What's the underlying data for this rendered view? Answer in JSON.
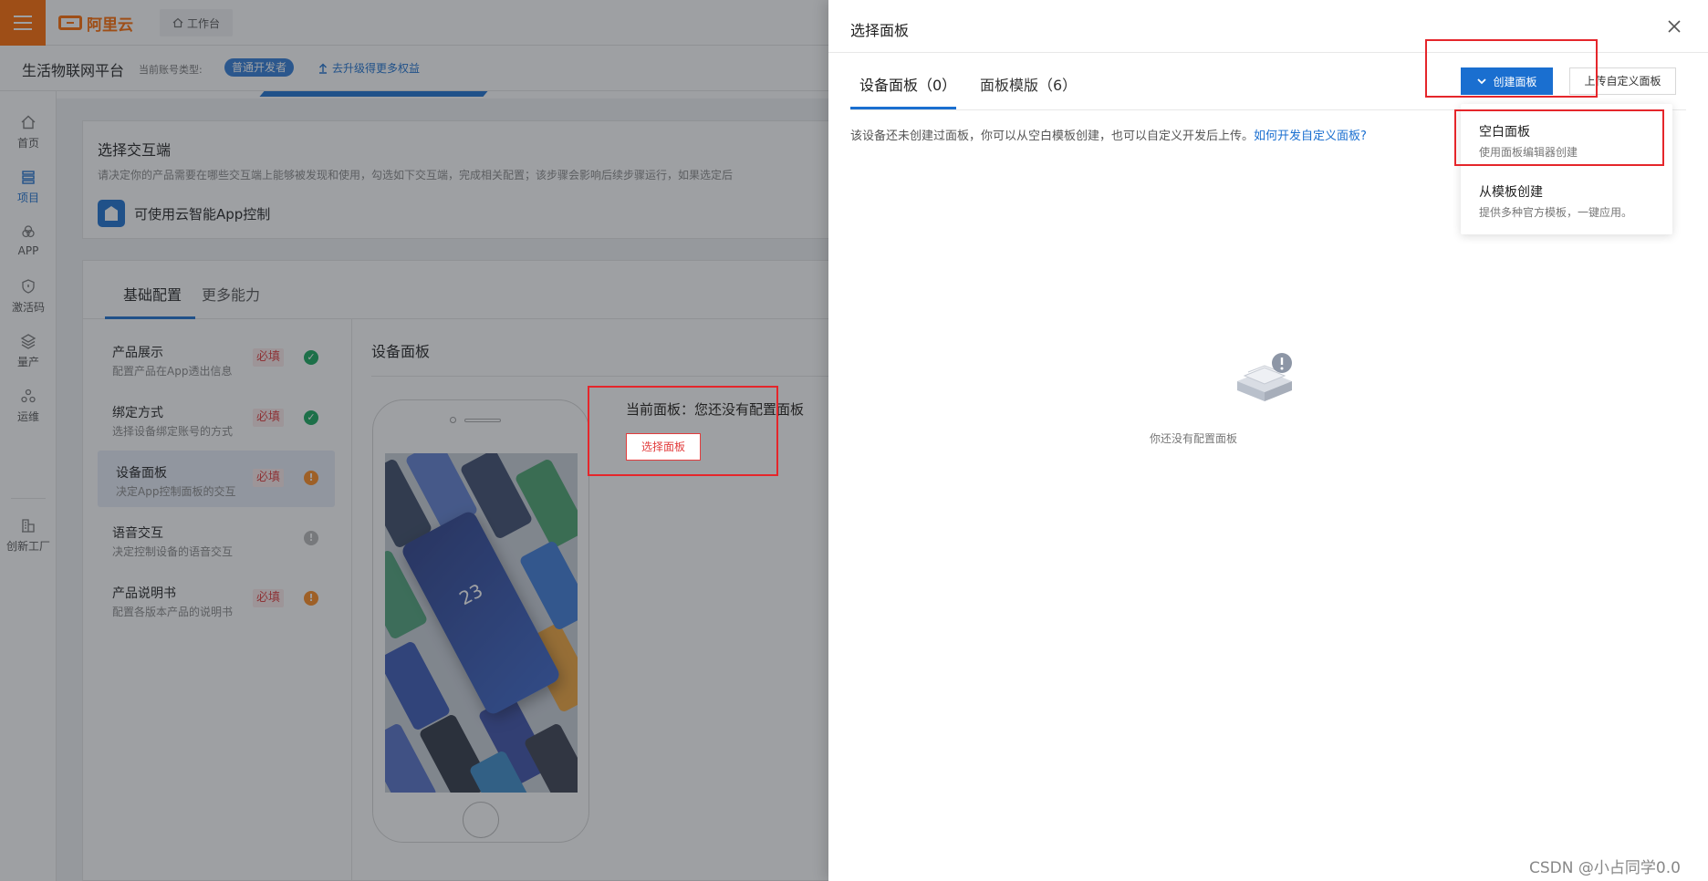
{
  "topbar": {
    "brand": "阿里云",
    "workbench": "工作台"
  },
  "subheader": {
    "platform": "生活物联网平台",
    "account_label": "当前账号类型:",
    "account_badge": "普通开发者",
    "upgrade": "去升级得更多权益"
  },
  "leftnav": {
    "items": [
      {
        "label": "首页",
        "icon": "home-icon"
      },
      {
        "label": "项目",
        "icon": "list-icon"
      },
      {
        "label": "APP",
        "icon": "app-icon"
      },
      {
        "label": "激活码",
        "icon": "shield-icon"
      },
      {
        "label": "量产",
        "icon": "layers-icon"
      },
      {
        "label": "运维",
        "icon": "ops-icon"
      },
      {
        "label": "创新工厂",
        "icon": "factory-icon"
      }
    ]
  },
  "interaction": {
    "title": "选择交互端",
    "desc": "请决定你的产品需要在哪些交互端上能够被发现和使用，勾选如下交互端，完成相关配置；该步骤会影响后续步骤运行，如果选定后",
    "app_control": "可使用云智能App控制"
  },
  "config_tabs": [
    "基础配置",
    "更多能力"
  ],
  "steps": [
    {
      "title": "产品展示",
      "desc": "配置产品在App透出信息",
      "required": "必填",
      "status": "done"
    },
    {
      "title": "绑定方式",
      "desc": "选择设备绑定账号的方式",
      "required": "必填",
      "status": "done"
    },
    {
      "title": "设备面板",
      "desc": "决定App控制面板的交互",
      "required": "必填",
      "status": "warning"
    },
    {
      "title": "语音交互",
      "desc": "决定控制设备的语音交互",
      "required": "",
      "status": "info"
    },
    {
      "title": "产品说明书",
      "desc": "配置各版本产品的说明书",
      "required": "必填",
      "status": "warning"
    }
  ],
  "panel_area": {
    "title": "设备面板",
    "current": "当前面板：您还没有配置面板",
    "select_btn": "选择面板",
    "phone_value": "23"
  },
  "drawer": {
    "title": "选择面板",
    "tabs": [
      "设备面板（0）",
      "面板模版（6）"
    ],
    "create_btn": "创建面板",
    "upload_btn": "上传自定义面板",
    "hint": "该设备还未创建过面板，你可以从空白模板创建，也可以自定义开发后上传。",
    "hint_link": "如何开发自定义面板?",
    "dropdown": [
      {
        "title": "空白面板",
        "desc": "使用面板编辑器创建"
      },
      {
        "title": "从模板创建",
        "desc": "提供多种官方模板，一键应用。"
      }
    ],
    "empty_text": "你还没有配置面板"
  },
  "watermark": "CSDN @小占同学0.0",
  "colors": {
    "brand_orange": "#ff6a00",
    "primary_blue": "#1a6fd0",
    "required_red": "#e23c3c",
    "annotation_red": "#e5262b"
  }
}
